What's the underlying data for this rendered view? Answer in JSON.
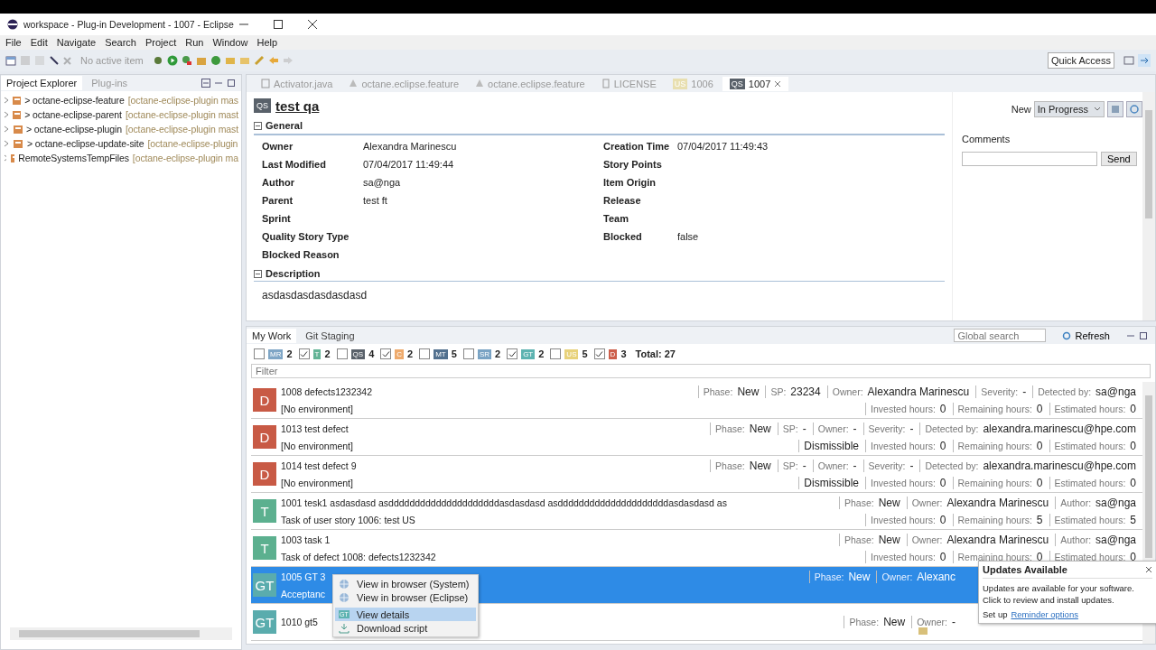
{
  "window": {
    "title": "workspace - Plug-in Development - 1007 - Eclipse"
  },
  "menu": [
    "File",
    "Edit",
    "Navigate",
    "Search",
    "Project",
    "Run",
    "Window",
    "Help"
  ],
  "toolbar": {
    "active_item": "No active item",
    "quick_access": "Quick Access"
  },
  "left_tabs": [
    {
      "label": "Project Explorer",
      "selected": true
    },
    {
      "label": "Plug-ins",
      "selected": false
    }
  ],
  "projects": [
    {
      "name": "> octane-eclipse-feature",
      "repo": "[octane-eclipse-plugin mas"
    },
    {
      "name": "> octane-eclipse-parent",
      "repo": "[octane-eclipse-plugin mast"
    },
    {
      "name": "> octane-eclipse-plugin",
      "repo": "[octane-eclipse-plugin mast"
    },
    {
      "name": "> octane-eclipse-update-site",
      "repo": "[octane-eclipse-plugin"
    },
    {
      "name": "RemoteSystemsTempFiles",
      "repo": "[octane-eclipse-plugin ma"
    }
  ],
  "editor_tabs": [
    {
      "label": "Activator.java",
      "kind": "java",
      "selected": false
    },
    {
      "label": "octane.eclipse.feature",
      "kind": "feature",
      "selected": false
    },
    {
      "label": "octane.eclipse.feature",
      "kind": "feature",
      "selected": false
    },
    {
      "label": "LICENSE",
      "kind": "file",
      "selected": false
    },
    {
      "label": "1006",
      "kind": "item",
      "badge": "US",
      "selected": false
    },
    {
      "label": "1007",
      "kind": "item",
      "badge": "QS",
      "selected": true
    }
  ],
  "item": {
    "badge": "QS",
    "title": "test qa",
    "phase": "New",
    "phase_select": "In Progress"
  },
  "general": {
    "title": "General",
    "left": [
      {
        "label": "Owner",
        "value": "Alexandra Marinescu"
      },
      {
        "label": "Last Modified",
        "value": "07/04/2017 11:49:44"
      },
      {
        "label": "Author",
        "value": "sa@nga"
      },
      {
        "label": "Parent",
        "value": "test ft"
      },
      {
        "label": "Sprint"
      },
      {
        "label": "Quality Story Type"
      },
      {
        "label": "Blocked Reason"
      }
    ],
    "right": [
      {
        "label": "Creation Time",
        "value": "07/04/2017 11:49:43"
      },
      {
        "label": "Story Points"
      },
      {
        "label": "Item Origin"
      },
      {
        "label": "Release"
      },
      {
        "label": "Team"
      },
      {
        "label": "Blocked",
        "value": "false"
      }
    ]
  },
  "comments": {
    "label": "Comments",
    "button": "Send"
  },
  "description": {
    "title": "Description",
    "text": "asdasdasdasdasdasd"
  },
  "bottom_tabs": [
    {
      "label": "My Work",
      "selected": true
    },
    {
      "label": "Git Staging",
      "selected": false
    }
  ],
  "global_search": {
    "placeholder": "Global search"
  },
  "refresh": "Refresh",
  "filters": [
    {
      "abbr": "MR",
      "color": "#7fa6c6",
      "count": "2",
      "checked": false
    },
    {
      "abbr": "T",
      "color": "#63b496",
      "count": "2",
      "checked": true
    },
    {
      "abbr": "QS",
      "color": "#59616a",
      "count": "4",
      "checked": false
    },
    {
      "abbr": "C",
      "color": "#eeaa6c",
      "count": "2",
      "checked": true
    },
    {
      "abbr": "MT",
      "color": "#52708e",
      "count": "5",
      "checked": false
    },
    {
      "abbr": "SR",
      "color": "#79a3c4",
      "count": "2",
      "checked": false
    },
    {
      "abbr": "GT",
      "color": "#5db3b1",
      "count": "2",
      "checked": true
    },
    {
      "abbr": "US",
      "color": "#e8d27a",
      "count": "5",
      "checked": false
    },
    {
      "abbr": "D",
      "color": "#cd5f4b",
      "count": "3",
      "checked": true
    }
  ],
  "total": "Total: 27",
  "filter_field": {
    "placeholder": "Filter"
  },
  "work_items": [
    {
      "badge": "D",
      "color": "#c85a45",
      "title": "1008 defects1232342",
      "subtitle": "[No environment]",
      "selected": false,
      "top": [
        {
          "label": "Phase:",
          "value": "New"
        },
        {
          "label": "SP:",
          "value": "23234"
        },
        {
          "label": "Owner:",
          "value": "Alexandra Marinescu"
        },
        {
          "label": "Severity:",
          "value": "-"
        },
        {
          "label": "Detected by:",
          "value": "sa@nga"
        }
      ],
      "bottom": [
        {
          "label": "Invested hours:",
          "value": "0"
        },
        {
          "label": "Remaining hours:",
          "value": "0"
        },
        {
          "label": "Estimated hours:",
          "value": "0"
        }
      ]
    },
    {
      "badge": "D",
      "color": "#c85a45",
      "title": "1013 test defect",
      "subtitle": "[No environment]",
      "selected": false,
      "top": [
        {
          "label": "Phase:",
          "value": "New"
        },
        {
          "label": "SP:",
          "value": "-"
        },
        {
          "label": "Owner:",
          "value": "-"
        },
        {
          "label": "Severity:",
          "value": "-"
        },
        {
          "label": "Detected by:",
          "value": "alexandra.marinescu@hpe.com"
        }
      ],
      "bottom": [
        {
          "value": "Dismissible"
        },
        {
          "label": "Invested hours:",
          "value": "0"
        },
        {
          "label": "Remaining hours:",
          "value": "0"
        },
        {
          "label": "Estimated hours:",
          "value": "0"
        }
      ]
    },
    {
      "badge": "D",
      "color": "#c85a45",
      "title": "1014 test defect 9",
      "subtitle": "[No environment]",
      "selected": false,
      "top": [
        {
          "label": "Phase:",
          "value": "New"
        },
        {
          "label": "SP:",
          "value": "-"
        },
        {
          "label": "Owner:",
          "value": "-"
        },
        {
          "label": "Severity:",
          "value": "-"
        },
        {
          "label": "Detected by:",
          "value": "alexandra.marinescu@hpe.com"
        }
      ],
      "bottom": [
        {
          "value": "Dismissible"
        },
        {
          "label": "Invested hours:",
          "value": "0"
        },
        {
          "label": "Remaining hours:",
          "value": "0"
        },
        {
          "label": "Estimated hours:",
          "value": "0"
        }
      ]
    },
    {
      "badge": "T",
      "color": "#5cb08f",
      "title": "1001 tesk1 asdasdasd asdddddddddddddddddddddasdasdasd asdddddddddddddddddddddasdasdasd as",
      "subtitle": "Task of user story 1006: test US",
      "selected": false,
      "top": [
        {
          "label": "Phase:",
          "value": "New"
        },
        {
          "label": "Owner:",
          "value": "Alexandra Marinescu"
        },
        {
          "label": "Author:",
          "value": "sa@nga"
        }
      ],
      "bottom": [
        {
          "label": "Invested hours:",
          "value": "0"
        },
        {
          "label": "Remaining hours:",
          "value": "5"
        },
        {
          "label": "Estimated hours:",
          "value": "5"
        }
      ]
    },
    {
      "badge": "T",
      "color": "#5cb08f",
      "title": "1003 task 1",
      "subtitle": "Task of defect 1008: defects1232342",
      "selected": false,
      "top": [
        {
          "label": "Phase:",
          "value": "New"
        },
        {
          "label": "Owner:",
          "value": "Alexandra Marinescu"
        },
        {
          "label": "Author:",
          "value": "sa@nga"
        }
      ],
      "bottom": [
        {
          "label": "Invested hours:",
          "value": "0"
        },
        {
          "label": "Remaining hours:",
          "value": "0"
        },
        {
          "label": "Estimated hours:",
          "value": "0"
        }
      ]
    },
    {
      "badge": "GT",
      "color": "#5aacad",
      "title": "1005 GT 3",
      "subtitle": "Acceptanc",
      "selected": true,
      "top": [
        {
          "label": "Phase:",
          "value": "New"
        },
        {
          "label": "Owner:",
          "value": "Alexanc"
        }
      ]
    },
    {
      "badge": "GT",
      "color": "#5aacad",
      "title": "1010 gt5",
      "selected": false,
      "top": [
        {
          "label": "Phase:",
          "value": "New"
        },
        {
          "label": "Owner:",
          "value": "-"
        }
      ]
    }
  ],
  "context_menu": [
    {
      "label": "View in browser (System)",
      "kind": "globe",
      "selected": false
    },
    {
      "label": "View in browser (Eclipse)",
      "kind": "globe",
      "selected": false
    },
    {
      "label": "View details",
      "kind": "badge",
      "badge": "GT",
      "selected": true
    },
    {
      "label": "Download script",
      "kind": "download",
      "selected": false
    }
  ],
  "notification": {
    "title": "Updates Available",
    "text": "Updates are available for your software. Click to review and install updates.",
    "setup": "Set up",
    "link": "Reminder options"
  }
}
